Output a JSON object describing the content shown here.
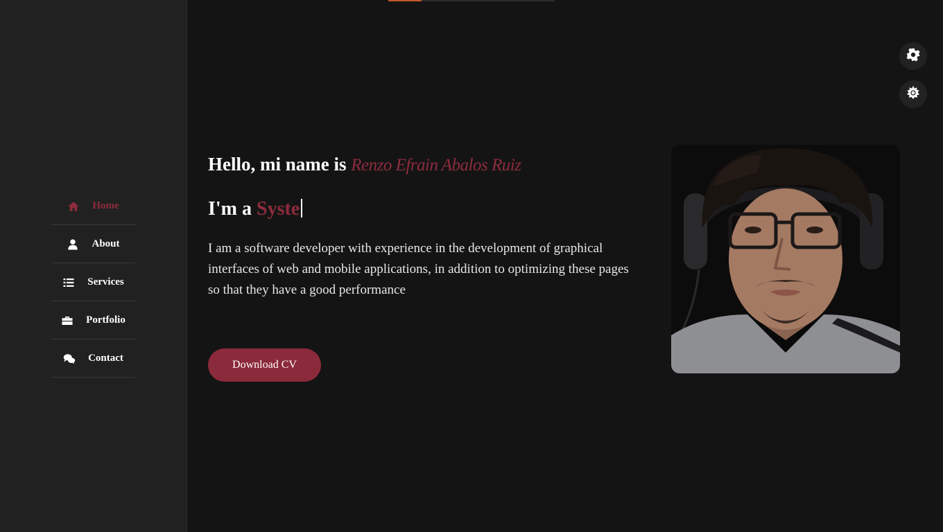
{
  "sidebar": {
    "items": [
      {
        "label": "Home",
        "icon": "home-icon",
        "active": true
      },
      {
        "label": "About",
        "icon": "user-icon",
        "active": false
      },
      {
        "label": "Services",
        "icon": "list-icon",
        "active": false
      },
      {
        "label": "Portfolio",
        "icon": "briefcase-icon",
        "active": false
      },
      {
        "label": "Contact",
        "icon": "comments-icon",
        "active": false
      }
    ]
  },
  "hero": {
    "greeting_prefix": "Hello, mi name is ",
    "name": "Renzo Efrain Abalos Ruiz",
    "role_prefix": "I'm a ",
    "role_typed": "Syste",
    "description": "I am a software developer with experience in the development of graphical interfaces of web and mobile applications, in addition to optimizing these pages so that they have a good performance",
    "download_label": "Download CV"
  },
  "controls": {
    "settings_icon": "gear-icon",
    "theme_icon": "sun-icon"
  },
  "colors": {
    "accent": "#8e2c3c",
    "background": "#151415",
    "sidebar": "#212121",
    "progress": "#c4582f"
  },
  "scroll_progress": 0.2
}
